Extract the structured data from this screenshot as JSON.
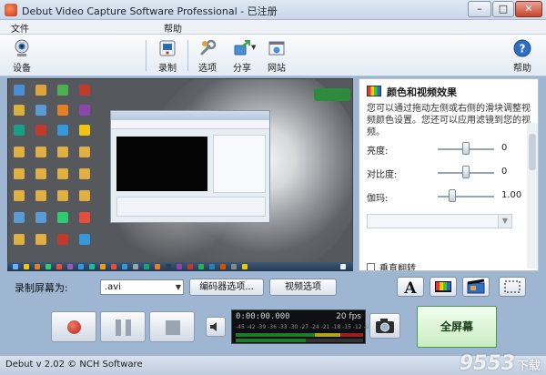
{
  "window": {
    "title": "Debut Video Capture Software Professional - 已注册",
    "btn_minimize": "–",
    "btn_maximize": "□",
    "btn_close": "✕"
  },
  "menu": {
    "file": "文件",
    "help": "帮助"
  },
  "toolbar": {
    "device": "设备",
    "record": "录制",
    "options": "选项",
    "share": "分享",
    "website": "网站",
    "help": "帮助"
  },
  "preview": {
    "badge": ""
  },
  "right_panel": {
    "title": "颜色和视频效果",
    "description": "您可以通过拖动左侧或右侧的滑块调整视频颜色设置。您还可以应用滤镜到您的视频。",
    "sliders": [
      {
        "label": "亮度:",
        "value": "0",
        "level": 0.5
      },
      {
        "label": "对比度:",
        "value": "0",
        "level": 0.5
      },
      {
        "label": "伽玛:",
        "value": "1.00",
        "level": 0.25
      }
    ],
    "checkbox_label": "垂直翻转"
  },
  "record_row": {
    "label": "录制屏幕为:",
    "format": ".avi",
    "encoder_button": "编码器选项...",
    "video_button": "视频选项"
  },
  "status": {
    "time": "0:00:00.000",
    "fps": "20 fps",
    "db_scale": "-45 -42 -39 -36 -33 -30 -27 -24 -21 -18 -15 -12 -9 -6 -3 0"
  },
  "controls": {
    "fullscreen": "全屏幕"
  },
  "footer": {
    "version": "Debut v 2.02 © NCH Software",
    "watermark_main": "9553",
    "watermark_sub": "下载"
  },
  "colors": {
    "accent": "#c0391b",
    "fullscreen_bg": "#c9ecc2",
    "meter_green": "#1f7a27"
  }
}
